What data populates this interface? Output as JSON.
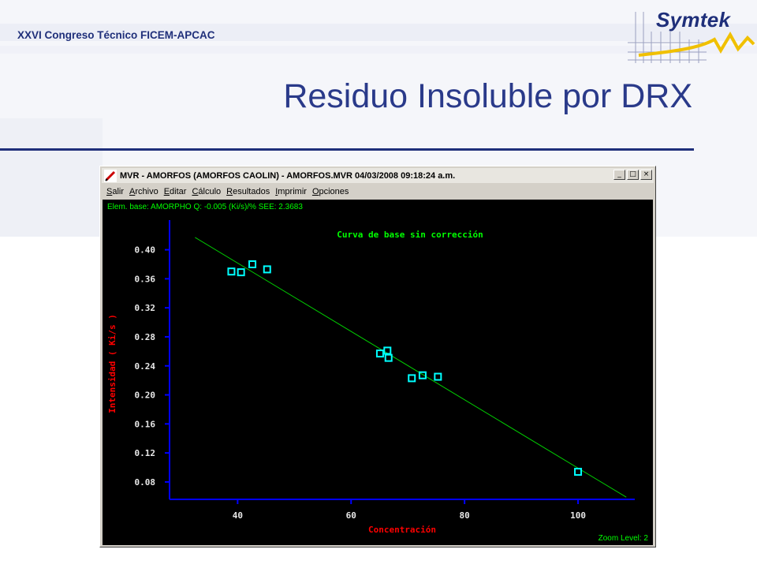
{
  "slide": {
    "header": "XXVI Congreso Técnico FICEM-APCAC",
    "logo_text": "Symtek",
    "title": "Residuo Insoluble por DRX"
  },
  "window": {
    "title": "MVR - AMORFOS (AMORFOS CAOLIN) - AMORFOS.MVR 04/03/2008 09:18:24 a.m.",
    "controls": {
      "minimize": "_",
      "maximize": "□",
      "close": "×"
    },
    "menu": [
      {
        "mnemonic": "S",
        "rest": "alir"
      },
      {
        "mnemonic": "A",
        "rest": "rchivo"
      },
      {
        "mnemonic": "E",
        "rest": "ditar"
      },
      {
        "mnemonic": "C",
        "rest": "álculo"
      },
      {
        "mnemonic": "R",
        "rest": "esultados"
      },
      {
        "mnemonic": "I",
        "rest": "mprimir"
      },
      {
        "mnemonic": "O",
        "rest": "pciones"
      }
    ],
    "status_top": "Elem. base: AMORPHO   Q: -0.005 (Ki/s)/%  SEE: 2.3683",
    "status_bottom": "Zoom Level: 2",
    "colors": {
      "plot_bg": "#000000",
      "axis": "#0000ff",
      "ticks_text": "#e8e8e8",
      "axis_title": "#ff0000",
      "chart_title": "#00ff00",
      "fit_line": "#00cc00",
      "points": "#00ffff"
    }
  },
  "chart_data": {
    "type": "scatter",
    "title": "Curva de base sin corrección",
    "xlabel": "Concentración",
    "ylabel": "Intensidad ( Ki/s )",
    "xlim": [
      28,
      110
    ],
    "ylim": [
      0.056,
      0.43
    ],
    "xticks": [
      40,
      60,
      80,
      100
    ],
    "xtick_labels": [
      "40",
      "60",
      "80",
      "100"
    ],
    "yticks": [
      0.08,
      0.12,
      0.16,
      0.2,
      0.24,
      0.28,
      0.32,
      0.36,
      0.4
    ],
    "ytick_labels": [
      "0.08",
      "0.12",
      "0.16",
      "0.20",
      "0.24",
      "0.28",
      "0.32",
      "0.36",
      "0.40"
    ],
    "grid": false,
    "points": [
      {
        "x": 38.9,
        "y": 0.37
      },
      {
        "x": 40.6,
        "y": 0.369
      },
      {
        "x": 42.6,
        "y": 0.38
      },
      {
        "x": 45.2,
        "y": 0.373
      },
      {
        "x": 65.1,
        "y": 0.257
      },
      {
        "x": 66.4,
        "y": 0.261
      },
      {
        "x": 66.6,
        "y": 0.251
      },
      {
        "x": 70.7,
        "y": 0.223
      },
      {
        "x": 72.6,
        "y": 0.227
      },
      {
        "x": 75.3,
        "y": 0.225
      },
      {
        "x": 100.0,
        "y": 0.094
      }
    ],
    "fit_line": {
      "x": [
        32.5,
        108.5
      ],
      "y": [
        0.417,
        0.059
      ]
    }
  }
}
